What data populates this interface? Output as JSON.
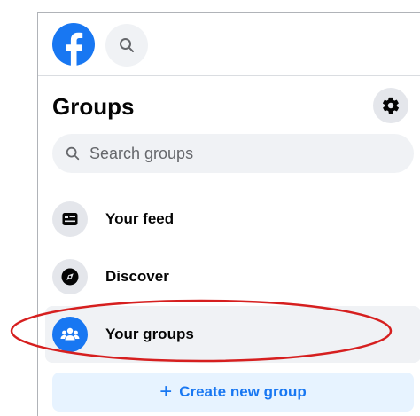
{
  "topbar": {
    "logo_icon": "facebook-logo-icon",
    "search_icon": "search-icon"
  },
  "groups": {
    "title": "Groups",
    "settings_icon": "gear-icon",
    "search_placeholder": "Search groups"
  },
  "nav": {
    "items": [
      {
        "label": "Your feed",
        "icon": "feed-icon",
        "active": false
      },
      {
        "label": "Discover",
        "icon": "compass-icon",
        "active": false
      },
      {
        "label": "Your groups",
        "icon": "groups-icon",
        "active": true
      }
    ]
  },
  "create": {
    "plus": "+",
    "label": "Create new group"
  },
  "colors": {
    "brand": "#1877f2",
    "highlight_annotation": "#d61f1f"
  }
}
